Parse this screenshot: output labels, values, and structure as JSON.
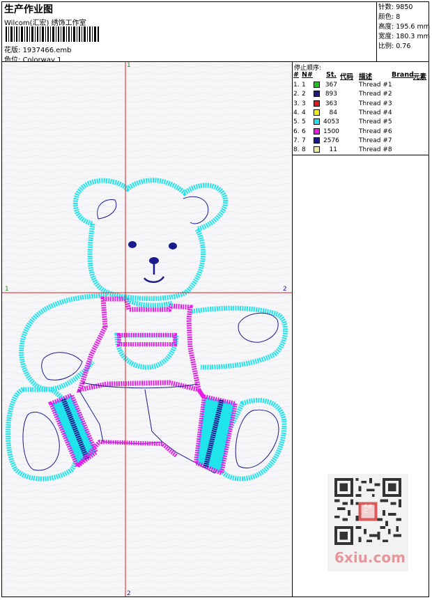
{
  "header": {
    "title": "生产作业图",
    "studio": "Wilcom(汇宏) 绣饰工作室",
    "design_label": "花版:",
    "design_value": "1937466.emb",
    "colorway_label": "色位:",
    "colorway_value": "Colorway 1"
  },
  "stats": [
    {
      "label": "针数:",
      "value": "9850"
    },
    {
      "label": "颜色:",
      "value": "8"
    },
    {
      "label": "高度:",
      "value": "195.6 mm"
    },
    {
      "label": "宽度:",
      "value": "180.3 mm"
    },
    {
      "label": "比例:",
      "value": "0.76"
    }
  ],
  "table": {
    "stop_title": "停止顺序:",
    "columns": [
      "#",
      "N#",
      "St.",
      "代码",
      "描述",
      "Brand",
      "元素"
    ],
    "rows": [
      {
        "idx": "1.",
        "n": "1",
        "color": "#22c01e",
        "st": "367",
        "desc": "Thread #1"
      },
      {
        "idx": "2.",
        "n": "2",
        "color": "#1a1a8c",
        "st": "893",
        "desc": "Thread #2"
      },
      {
        "idx": "3.",
        "n": "3",
        "color": "#e01b1b",
        "st": "363",
        "desc": "Thread #3"
      },
      {
        "idx": "4.",
        "n": "4",
        "color": "#f2ef1e",
        "st": "84",
        "desc": "Thread #4"
      },
      {
        "idx": "5.",
        "n": "5",
        "color": "#1fe4ec",
        "st": "4053",
        "desc": "Thread #5"
      },
      {
        "idx": "6.",
        "n": "6",
        "color": "#e81ee8",
        "st": "1500",
        "desc": "Thread #6"
      },
      {
        "idx": "7.",
        "n": "7",
        "color": "#1a1a8c",
        "st": "2576",
        "desc": "Thread #7"
      },
      {
        "idx": "8.",
        "n": "8",
        "color": "#f3ee9c",
        "st": "11",
        "desc": "Thread #8"
      }
    ]
  },
  "axes": {
    "top": "1",
    "bottom": "2",
    "left": "1",
    "right": "2"
  },
  "watermark": {
    "text": "6xiu.com",
    "stamp": "秀绣汇"
  },
  "colors": {
    "cyan": "#1fe4ec",
    "magenta": "#e81ee8",
    "navy": "#1a1a8c",
    "axis": "#e01b1b"
  }
}
